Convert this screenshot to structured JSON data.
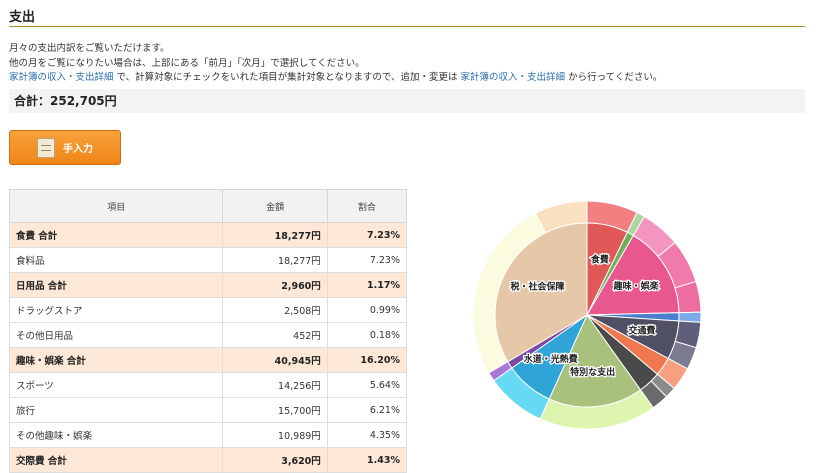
{
  "page": {
    "title": "支出",
    "desc_line1": "月々の支出内訳をご覧いただけます。",
    "desc_line2": "他の月をご覧になりたい場合は、上部にある「前月」「次月」で選択してください。",
    "desc_link1": "家計簿の収入・支出詳細",
    "desc_mid": "で、計算対象にチェックをいれた項目が集計対象となりますので、追加・変更は",
    "desc_link2": "家計簿の収入・支出詳細",
    "desc_end": "から行ってください。",
    "total": "合計：252,705円",
    "manual_button": "手入力",
    "icon": "memo-icon"
  },
  "table": {
    "headers": [
      "項目",
      "金額",
      "割合"
    ],
    "rows": [
      {
        "item": "食費 合計",
        "amount": "18,277円",
        "ratio": "7.23%",
        "group": true
      },
      {
        "item": "食料品",
        "amount": "18,277円",
        "ratio": "7.23%",
        "group": false
      },
      {
        "item": "日用品 合計",
        "amount": "2,960円",
        "ratio": "1.17%",
        "group": true
      },
      {
        "item": "ドラッグストア",
        "amount": "2,508円",
        "ratio": "0.99%",
        "group": false
      },
      {
        "item": "その他日用品",
        "amount": "452円",
        "ratio": "0.18%",
        "group": false
      },
      {
        "item": "趣味・娯楽 合計",
        "amount": "40,945円",
        "ratio": "16.20%",
        "group": true
      },
      {
        "item": "スポーツ",
        "amount": "14,256円",
        "ratio": "5.64%",
        "group": false
      },
      {
        "item": "旅行",
        "amount": "15,700円",
        "ratio": "6.21%",
        "group": false
      },
      {
        "item": "その他趣味・娯楽",
        "amount": "10,989円",
        "ratio": "4.35%",
        "group": false
      },
      {
        "item": "交際費 合計",
        "amount": "3,620円",
        "ratio": "1.43%",
        "group": true
      }
    ]
  },
  "chart_data": {
    "type": "pie",
    "inner": [
      {
        "label": "食費",
        "pct": 7.23,
        "color": "#e05858"
      },
      {
        "label": "",
        "pct": 1.17,
        "color": "#6fae5a"
      },
      {
        "label": "趣味・娯楽",
        "pct": 16.2,
        "color": "#e8578e"
      },
      {
        "label": "",
        "pct": 1.43,
        "color": "#4a7fd0"
      },
      {
        "label": "交通費",
        "pct": 6.8,
        "color": "#4f4f66"
      },
      {
        "label": "",
        "pct": 3.3,
        "color": "#f07850"
      },
      {
        "label": "",
        "pct": 4.0,
        "color": "#4a4a4a"
      },
      {
        "label": "特別な支出",
        "pct": 16.6,
        "color": "#a8c27e"
      },
      {
        "label": "水道・光熱費",
        "pct": 8.5,
        "color": "#2fa4d6"
      },
      {
        "label": "",
        "pct": 1.3,
        "color": "#7a48a8"
      },
      {
        "label": "税・社会保障",
        "pct": 33.47,
        "color": "#e6c8a8"
      }
    ],
    "outer": [
      {
        "pct": 7.23,
        "color": "#f28080"
      },
      {
        "pct": 1.17,
        "color": "#a8d8a0"
      },
      {
        "pct": 5.64,
        "color": "#f495c0"
      },
      {
        "pct": 6.21,
        "color": "#f07aaa"
      },
      {
        "pct": 4.35,
        "color": "#ee6da0"
      },
      {
        "pct": 1.43,
        "color": "#7aaae8"
      },
      {
        "pct": 3.6,
        "color": "#5f5f7a"
      },
      {
        "pct": 3.2,
        "color": "#7a7a90"
      },
      {
        "pct": 3.3,
        "color": "#f6a080"
      },
      {
        "pct": 1.6,
        "color": "#8a8a8a"
      },
      {
        "pct": 2.4,
        "color": "#6a6a6a"
      },
      {
        "pct": 16.6,
        "color": "#def5b0"
      },
      {
        "pct": 8.5,
        "color": "#66daf5"
      },
      {
        "pct": 1.3,
        "color": "#a878d8"
      },
      {
        "pct": 26.0,
        "color": "#fbfbe0"
      },
      {
        "pct": 7.47,
        "color": "#fbe0c0"
      }
    ]
  }
}
